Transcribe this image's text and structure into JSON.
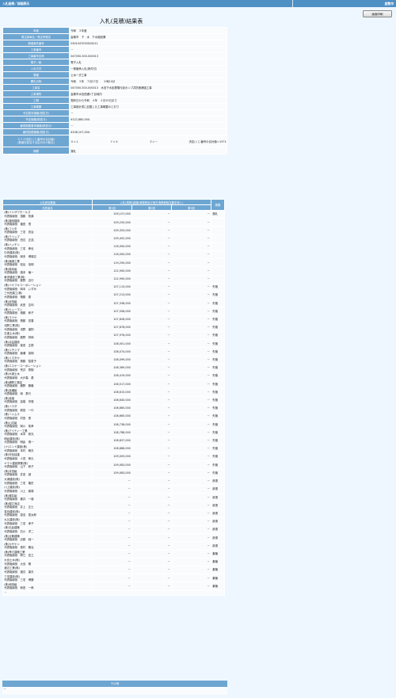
{
  "header": {
    "breadcrumb": "入札結果／詳細表示",
    "right_label": "倉敷市",
    "print_label": "画面印刷"
  },
  "title": "入札(見積)結果表",
  "info": [
    {
      "label": "年度",
      "value": "令和　３年度"
    },
    {
      "label": "発注部局名／発注所属名",
      "value": "倉敷市　下　水　下水施設課"
    },
    {
      "label": "調達案件番号",
      "value": "0301047050020011"
    },
    {
      "label": "工事番号",
      "value": "－"
    },
    {
      "label": "工事番号名称",
      "value": "047050-503-000013"
    },
    {
      "label": "電子／紙",
      "value": "電子入札"
    },
    {
      "label": "入札方式",
      "value": "一般競争入札(条件付)"
    },
    {
      "label": "業種",
      "value": "土木一式工事"
    },
    {
      "label": "開札日時",
      "value": "令和　３年　７月27日　　９時10分"
    },
    {
      "label": "工事名",
      "value": "047050-503-000013　水島下水処理場汚泥ポンプ井防食補強工事"
    },
    {
      "label": "工事場所",
      "value": "倉敷市水島西通1丁目地内"
    },
    {
      "label": "工期",
      "value": "契約日から令和　４年　２月15日まで"
    },
    {
      "label": "工事概要",
      "value": "工事設計書に記載した工事概要のとおり"
    },
    {
      "label": "予定基本価格(税抜き)",
      "value": "－"
    },
    {
      "label": "予定価格(税抜き)",
      "value": "¥122,880,000-"
    },
    {
      "label": "最低制限基本価格(税抜き)",
      "value": "－"
    },
    {
      "label": "最低制限価格(税抜き)",
      "value": "¥108,107,000-"
    }
  ],
  "mlp": {
    "label1": "ＸＹＺ決定(くじ番号の合計値)",
    "label2": "(数値を該当する区分の小数点)",
    "x": "Ｘ＝１",
    "y": "Ｙ＝４",
    "z": "Ｚ＝－",
    "note": "決定(くじ番号の合計値＝15714"
  },
  "result": {
    "label": "摘要",
    "value": "落札"
  },
  "bid_table": {
    "header_company": "入札参加業者",
    "header_rep": "代表者名",
    "header_amount_group": "入札(見積)金額(消費税及び地方消費税相当額を除く)",
    "header_r1": "第1回",
    "header_r2": "第2回",
    "header_r3": "第3回",
    "header_remarks": "摘要",
    "rows": [
      {
        "company": "(株)イシザワホールズ",
        "rep": "代表取締役　須藤　知典",
        "r1": "109,157,000",
        "r2": "－",
        "r3": "－",
        "remark": "落札"
      },
      {
        "company": "(株)福田建設",
        "rep": "代表取締役　福田　悟",
        "r1": "109,255,000",
        "r2": "－",
        "r3": "－",
        "remark": ""
      },
      {
        "company": "(株)フジタ",
        "rep": "代表取締役　三宅　亮治",
        "r1": "109,353,000",
        "r2": "－",
        "r3": "－",
        "remark": ""
      },
      {
        "company": "(株)クリップ",
        "rep": "代表取締役　田辺　正浩",
        "r1": "109,452,000",
        "r2": "－",
        "r3": "－",
        "remark": ""
      },
      {
        "company": "(株)ハッチン",
        "rep": "代表取締役　三宅　伸也",
        "r1": "116,000,000",
        "r2": "－",
        "r3": "－",
        "remark": ""
      },
      {
        "company": "中央建設(株)",
        "rep": "代表取締役　岡本　博雄志",
        "r1": "116,000,000",
        "r2": "－",
        "r3": "－",
        "remark": ""
      },
      {
        "company": "(株)福浦工業",
        "rep": "代表取締役　松谷　信明",
        "r1": "119,290,000",
        "r2": "－",
        "r3": "－",
        "remark": ""
      },
      {
        "company": "(株)橋本組",
        "rep": "代表取締役　橋本　竜一",
        "r1": "122,900,000",
        "r2": "－",
        "r3": "－",
        "remark": ""
      },
      {
        "company": "東洋建設工業(株)",
        "rep": "代表取締役　藤野　吉行",
        "r1": "122,990,000",
        "r2": "－",
        "r3": "－",
        "remark": ""
      },
      {
        "company": "(株)ハヤフキコーポレーション",
        "rep": "代表取締役　岡本　いずみ",
        "r1": "107,115,000",
        "r2": "－",
        "r3": "－",
        "remark": "失格"
      },
      {
        "company": "三代田建工(株)",
        "rep": "代表取締役　檜藤　慶",
        "r1": "107,213,000",
        "r2": "－",
        "r3": "－",
        "remark": "失格"
      },
      {
        "company": "(株)武田組",
        "rep": "代表取締役　武田　吉利",
        "r1": "107,336,000",
        "r2": "－",
        "r3": "－",
        "remark": "失格"
      },
      {
        "company": "(株)ヒューマン",
        "rep": "代表取締役　檜藤　和子",
        "r1": "107,558,000",
        "r2": "－",
        "r3": "－",
        "remark": "失格"
      },
      {
        "company": "(株)マツヤ",
        "rep": "代表取締役　檜藤　宏春",
        "r1": "107,828,000",
        "r2": "－",
        "r3": "－",
        "remark": "失格"
      },
      {
        "company": "浅野工業(株)",
        "rep": "代表取締役　浅野　康則",
        "r1": "107,878,000",
        "r2": "－",
        "r3": "－",
        "remark": "失格"
      },
      {
        "company": "日進土木(株)",
        "rep": "代表取締役　藤野　祥和",
        "r1": "107,976,000",
        "r2": "－",
        "r3": "－",
        "remark": "失格"
      },
      {
        "company": "(株)北益建設",
        "rep": "代表取締役　楽田　正慶",
        "r1": "108,001,000",
        "r2": "－",
        "r3": "－",
        "remark": "失格"
      },
      {
        "company": "(株)ツチシマ",
        "rep": "代表取締役　綾瀬　英明",
        "r1": "108,074,000",
        "r2": "－",
        "r3": "－",
        "remark": "失格"
      },
      {
        "company": "(株)ミズタカ",
        "rep": "代表取締役　檜藤　智恵子",
        "r1": "108,099,000",
        "r2": "－",
        "r3": "－",
        "remark": "失格"
      },
      {
        "company": "(株)エスケーコーポレーション",
        "rep": "代表取締役　荒井　秀樹",
        "r1": "108,369,000",
        "r2": "－",
        "r3": "－",
        "remark": "失格"
      },
      {
        "company": "(株)大城土木",
        "rep": "代表取締役　大戸森　昌",
        "r1": "108,419,000",
        "r2": "－",
        "r3": "－",
        "remark": "失格"
      },
      {
        "company": "(株)績野工務店",
        "rep": "代表取締役　績野　勝義",
        "r1": "108,517,000",
        "r2": "－",
        "r3": "－",
        "remark": "失格"
      },
      {
        "company": "(株)高瀬組",
        "rep": "代表取締役　岡　泰行",
        "r1": "108,615,000",
        "r2": "－",
        "r3": "－",
        "remark": "失格"
      },
      {
        "company": "(株)高橋",
        "rep": "代表取締役　高橋　宗雄",
        "r1": "108,640,000",
        "r2": "－",
        "r3": "－",
        "remark": "失格"
      },
      {
        "company": "(株)ハラダ",
        "rep": "代表取締役　原田　一行",
        "r1": "108,665,000",
        "r2": "－",
        "r3": "－",
        "remark": "失格"
      },
      {
        "company": "(株)ニシムラ",
        "rep": "代表取締役　村田　勇",
        "r1": "108,665,000",
        "r2": "－",
        "r3": "－",
        "remark": "失格"
      },
      {
        "company": "(株)山辺組",
        "rep": "代表取締役　岡川　祐孝",
        "r1": "108,738,000",
        "r2": "－",
        "r3": "－",
        "remark": "失格"
      },
      {
        "company": "(株)アイティー工業",
        "rep": "代表取締役　木本　政光",
        "r1": "108,788,000",
        "r2": "－",
        "r3": "－",
        "remark": "失格"
      },
      {
        "company": "明倉建設(株)",
        "rep": "代表取締役　明倉　慎一",
        "r1": "108,837,000",
        "r2": "－",
        "r3": "－",
        "remark": "失格"
      },
      {
        "company": "(ナ)エンド建設(株)",
        "rep": "代表取締役　本村　絢夫",
        "r1": "108,886,000",
        "r2": "－",
        "r3": "－",
        "remark": "失格"
      },
      {
        "company": "(株)児島技建",
        "rep": "代表取締役　人見　伸久",
        "r1": "109,009,000",
        "r2": "－",
        "r3": "－",
        "remark": "失格"
      },
      {
        "company": "ヤマト建設興業(株)",
        "rep": "代表取締役　山下　和子",
        "r1": "109,083,000",
        "r2": "－",
        "r3": "－",
        "remark": "失格"
      },
      {
        "company": "(株)井田組",
        "rep": "代表取締役　井田　誠",
        "r1": "109,083,000",
        "r2": "－",
        "r3": "－",
        "remark": "失格"
      },
      {
        "company": "大浦建設(株)",
        "rep": "代表取締役　三宅　隆史",
        "r1": "－",
        "r2": "－",
        "r3": "－",
        "remark": "辞退"
      },
      {
        "company": "川上建設(株)",
        "rep": "代表取締役　川上　敦雄",
        "r1": "－",
        "r2": "－",
        "r3": "－",
        "remark": "辞退"
      },
      {
        "company": "(株)瀧井組",
        "rep": "代表取締役　瀧井　一雄",
        "r1": "－",
        "r2": "－",
        "r3": "－",
        "remark": "辞退"
      },
      {
        "company": "(株)堀江商店",
        "rep": "代表取締役　井上　正士",
        "r1": "－",
        "r2": "－",
        "r3": "－",
        "remark": "辞退"
      },
      {
        "company": "葛島建設(株)",
        "rep": "代表取締役　葛島　恵太郎",
        "r1": "－",
        "r2": "－",
        "r3": "－",
        "remark": "辞退"
      },
      {
        "company": "九久建設(株)",
        "rep": "代表取締役　三宅　孝子",
        "r1": "－",
        "r2": "－",
        "r3": "－",
        "remark": "辞退"
      },
      {
        "company": "(株)石倉建築",
        "rep": "代表取締役　石川　洋二",
        "r1": "－",
        "r2": "－",
        "r3": "－",
        "remark": "辞退"
      },
      {
        "company": "(株)近藤建築",
        "rep": "代表取締役　近藤　純一",
        "r1": "－",
        "r2": "－",
        "r3": "－",
        "remark": "辞退"
      },
      {
        "company": "(株)カザケン",
        "rep": "代表取締役　風村　勝治",
        "r1": "－",
        "r2": "－",
        "r3": "－",
        "remark": "辞退"
      },
      {
        "company": "(株)摩江建築工業",
        "rep": "代表取締役　摩江　宏之",
        "r1": "－",
        "r2": "－",
        "r3": "－",
        "remark": "棄権"
      },
      {
        "company": "大島土木(株)",
        "rep": "代表取締役　大島　剛",
        "r1": "－",
        "r2": "－",
        "r3": "－",
        "remark": "棄権"
      },
      {
        "company": "渡辺工業(株)",
        "rep": "代表取締役　渡辺　康夫",
        "r1": "－",
        "r2": "－",
        "r3": "－",
        "remark": "棄権"
      },
      {
        "company": "三宅建設(株)",
        "rep": "代表取締役　三宅　博勝",
        "r1": "－",
        "r2": "－",
        "r3": "－",
        "remark": "棄権"
      },
      {
        "company": "(株)和田組",
        "rep": "代表取締役　和田　一郎",
        "r1": "－",
        "r2": "－",
        "r3": "－",
        "remark": "棄権"
      }
    ],
    "trailing": "－"
  },
  "other": {
    "label": "その他",
    "value": "－"
  }
}
